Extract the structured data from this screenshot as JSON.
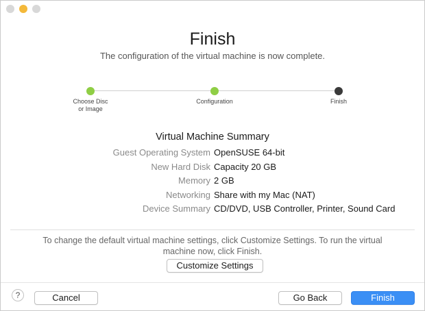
{
  "window": {
    "controls": [
      {
        "name": "close",
        "color": "#d8d8d8"
      },
      {
        "name": "minimize",
        "color": "#f4b93a"
      },
      {
        "name": "zoom",
        "color": "#d8d8d8"
      }
    ]
  },
  "header": {
    "title": "Finish",
    "subtitle": "The configuration of the virtual machine is now complete."
  },
  "steps": [
    {
      "label": "Choose Disc\nor Image",
      "state": "complete",
      "color": "#8fce45"
    },
    {
      "label": "Configuration",
      "state": "complete",
      "color": "#8fce45"
    },
    {
      "label": "Finish",
      "state": "current",
      "color": "#3a3a3a"
    }
  ],
  "summary": {
    "title": "Virtual Machine Summary",
    "rows": [
      {
        "key": "Guest Operating System",
        "value": "OpenSUSE 64-bit"
      },
      {
        "key": "New Hard Disk",
        "value": "Capacity 20 GB"
      },
      {
        "key": "Memory",
        "value": "2 GB"
      },
      {
        "key": "Networking",
        "value": "Share with my Mac (NAT)"
      },
      {
        "key": "Device Summary",
        "value": "CD/DVD, USB Controller, Printer, Sound Card"
      }
    ]
  },
  "info": {
    "text": "To change the default virtual machine settings, click Customize Settings. To run the virtual machine now, click Finish."
  },
  "buttons": {
    "customize": "Customize Settings",
    "help": "?",
    "cancel": "Cancel",
    "go_back": "Go Back",
    "finish": "Finish"
  },
  "colors": {
    "accent": "#3b8ff5",
    "step_complete": "#8fce45",
    "step_current": "#3a3a3a"
  }
}
